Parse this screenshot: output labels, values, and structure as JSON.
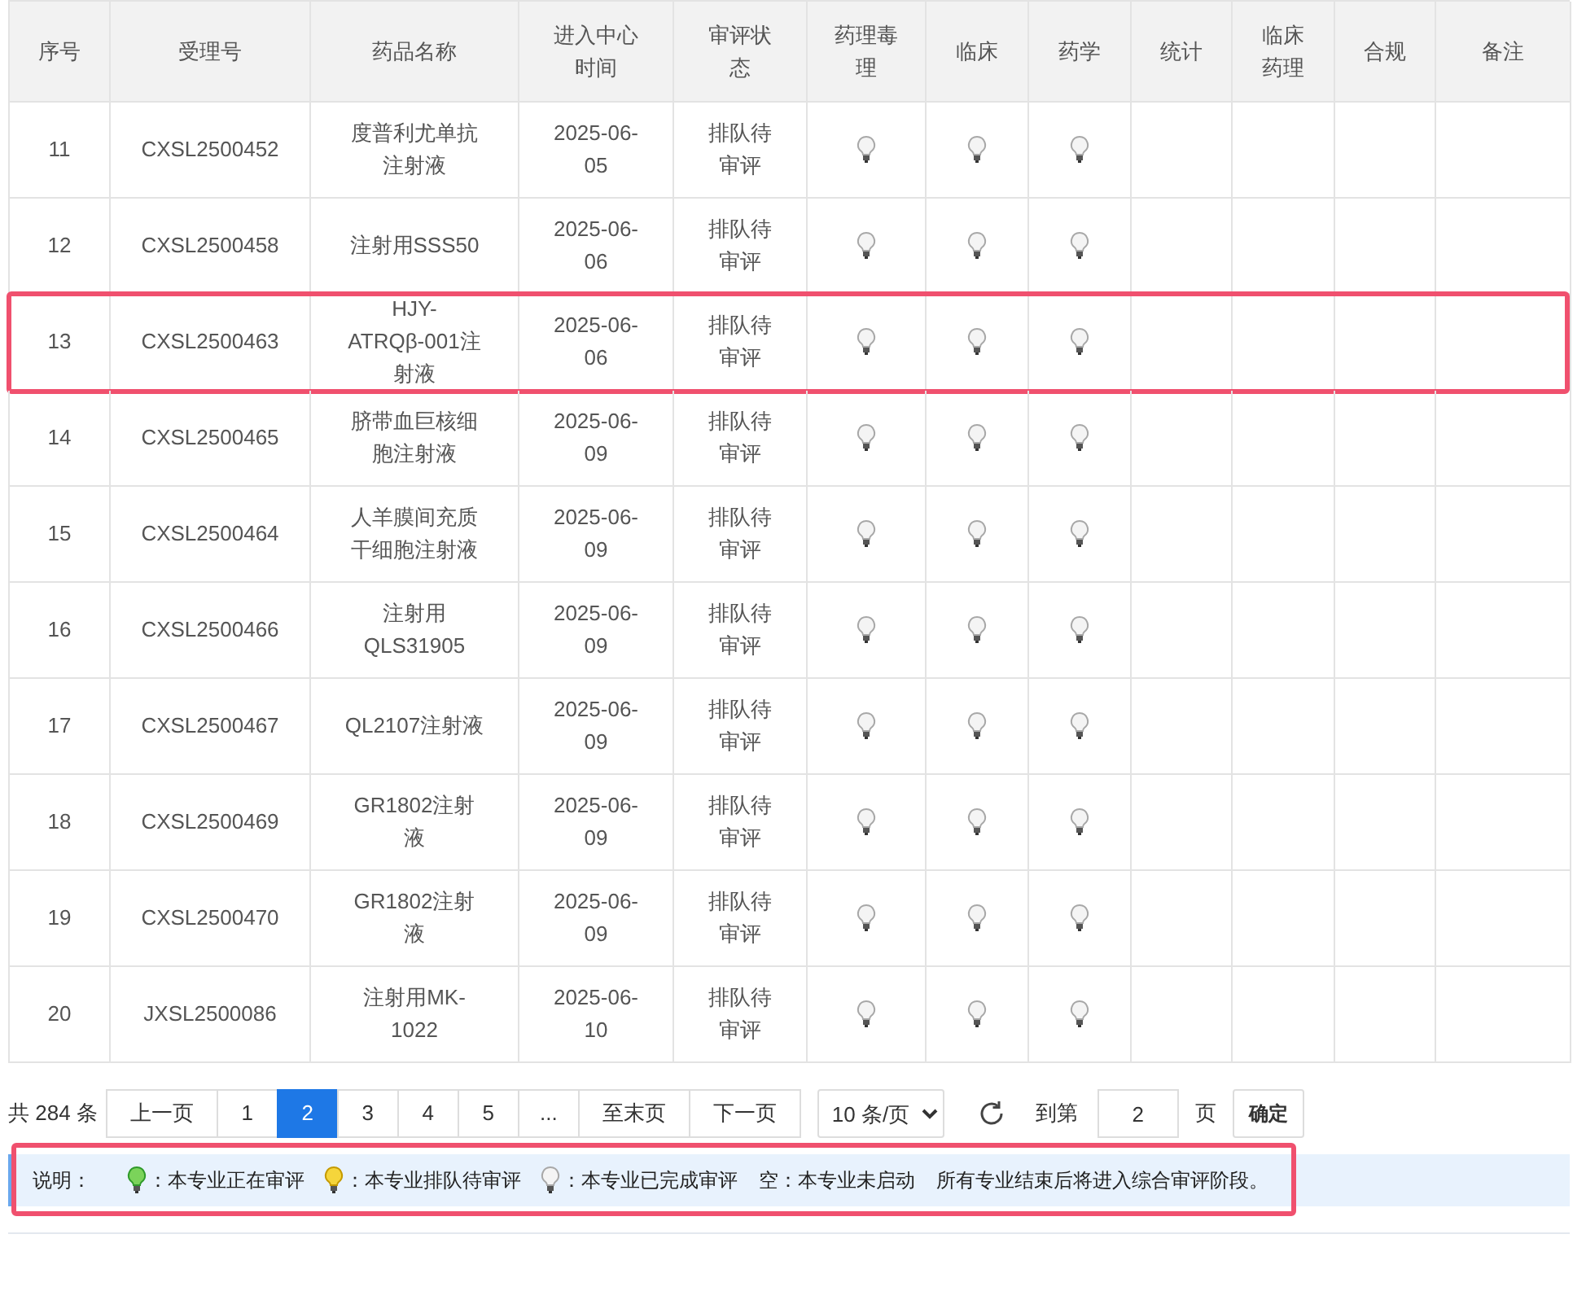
{
  "table": {
    "columns": [
      "序号",
      "受理号",
      "药品名称",
      "进入中心时间",
      "审评状态",
      "药理毒理",
      "临床",
      "药学",
      "统计",
      "临床药理",
      "合规",
      "备注"
    ],
    "rows": [
      {
        "no": "11",
        "accept_no": "CXSL2500452",
        "drug": "度普利尤单抗注射液",
        "date": "2025-06-05",
        "status": "排队待审评",
        "highlighted": false,
        "bulbs": [
          {
            "kind": "done"
          },
          {
            "kind": "done"
          },
          {
            "kind": "done"
          }
        ]
      },
      {
        "no": "12",
        "accept_no": "CXSL2500458",
        "drug": "注射用SSS50",
        "date": "2025-06-06",
        "status": "排队待审评",
        "highlighted": false,
        "bulbs": [
          {
            "kind": "done"
          },
          {
            "kind": "done"
          },
          {
            "kind": "done"
          }
        ]
      },
      {
        "no": "13",
        "accept_no": "CXSL2500463",
        "drug": "HJY-ATRQβ-001注射液",
        "date": "2025-06-06",
        "status": "排队待审评",
        "highlighted": true,
        "bulbs": [
          {
            "kind": "done"
          },
          {
            "kind": "done"
          },
          {
            "kind": "done"
          }
        ]
      },
      {
        "no": "14",
        "accept_no": "CXSL2500465",
        "drug": "脐带血巨核细胞注射液",
        "date": "2025-06-09",
        "status": "排队待审评",
        "highlighted": false,
        "bulbs": [
          {
            "kind": "done"
          },
          {
            "kind": "done"
          },
          {
            "kind": "done"
          }
        ]
      },
      {
        "no": "15",
        "accept_no": "CXSL2500464",
        "drug": "人羊膜间充质干细胞注射液",
        "date": "2025-06-09",
        "status": "排队待审评",
        "highlighted": false,
        "bulbs": [
          {
            "kind": "done"
          },
          {
            "kind": "done"
          },
          {
            "kind": "done"
          }
        ]
      },
      {
        "no": "16",
        "accept_no": "CXSL2500466",
        "drug": "注射用QLS31905",
        "date": "2025-06-09",
        "status": "排队待审评",
        "highlighted": false,
        "bulbs": [
          {
            "kind": "done"
          },
          {
            "kind": "done"
          },
          {
            "kind": "done"
          }
        ]
      },
      {
        "no": "17",
        "accept_no": "CXSL2500467",
        "drug": "QL2107注射液",
        "date": "2025-06-09",
        "status": "排队待审评",
        "highlighted": false,
        "bulbs": [
          {
            "kind": "done"
          },
          {
            "kind": "done"
          },
          {
            "kind": "done"
          }
        ]
      },
      {
        "no": "18",
        "accept_no": "CXSL2500469",
        "drug": "GR1802注射液",
        "date": "2025-06-09",
        "status": "排队待审评",
        "highlighted": false,
        "bulbs": [
          {
            "kind": "done"
          },
          {
            "kind": "done"
          },
          {
            "kind": "done"
          }
        ]
      },
      {
        "no": "19",
        "accept_no": "CXSL2500470",
        "drug": "GR1802注射液",
        "date": "2025-06-09",
        "status": "排队待审评",
        "highlighted": false,
        "bulbs": [
          {
            "kind": "done"
          },
          {
            "kind": "done"
          },
          {
            "kind": "done"
          }
        ]
      },
      {
        "no": "20",
        "accept_no": "JXSL2500086",
        "drug": "注射用MK-1022",
        "date": "2025-06-10",
        "status": "排队待审评",
        "highlighted": false,
        "bulbs": [
          {
            "kind": "done"
          },
          {
            "kind": "done"
          },
          {
            "kind": "done"
          }
        ]
      }
    ]
  },
  "pagination": {
    "total": "共 284 条",
    "pages": [
      {
        "label": "上一页",
        "selected": false
      },
      {
        "label": "1",
        "selected": false
      },
      {
        "label": "2",
        "selected": true
      },
      {
        "label": "3",
        "selected": false
      },
      {
        "label": "4",
        "selected": false
      },
      {
        "label": "5",
        "selected": false
      },
      {
        "label": "...",
        "selected": false
      },
      {
        "label": "至末页",
        "selected": false
      },
      {
        "label": "下一页",
        "selected": false
      }
    ],
    "page_size": "10 条/页",
    "goto_label": "到第",
    "goto_value": "2",
    "page_unit": "页",
    "confirm": "确定"
  },
  "legend": {
    "highlighted": true,
    "title": "说明：",
    "items": [
      {
        "kind": "active",
        "text": "：本专业正在审评"
      },
      {
        "kind": "queued",
        "text": "：本专业排队待审评"
      },
      {
        "kind": "done",
        "text": "：本专业已完成审评"
      },
      {
        "kind": "empty",
        "text": "空：本专业未启动"
      },
      {
        "kind": "note",
        "text": "所有专业结束后将进入综合审评阶段。"
      }
    ]
  }
}
